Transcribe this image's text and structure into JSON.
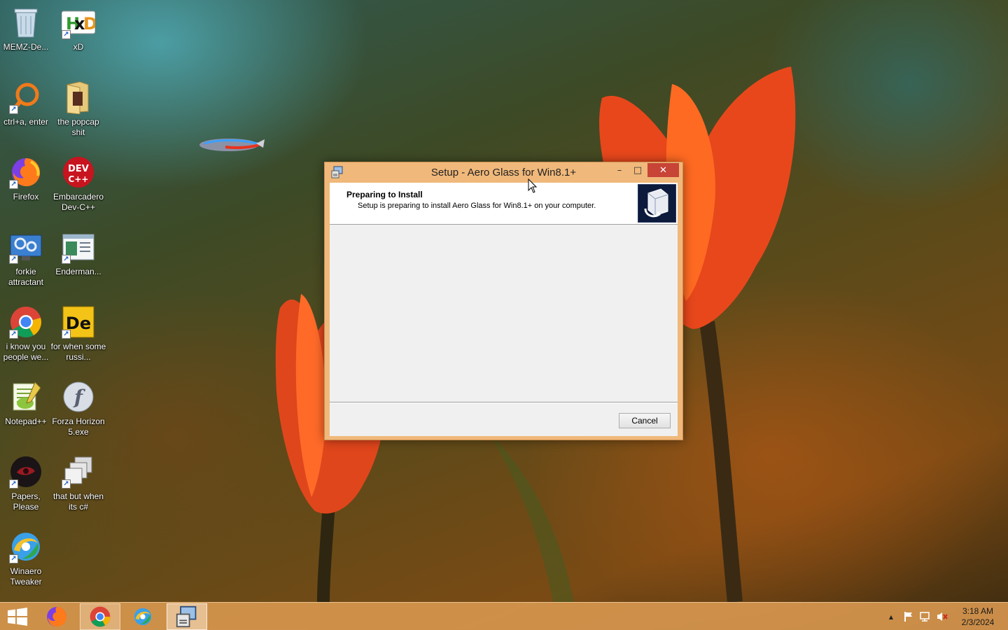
{
  "desktop": {
    "icons": [
      {
        "label": "MEMZ-De...",
        "icon": "recycle-bin-icon"
      },
      {
        "label": "xD",
        "icon": "hxd-icon"
      },
      {
        "label": "ctrl+a, enter",
        "icon": "magnifier-icon"
      },
      {
        "label": "the popcap shit",
        "icon": "folder-icon"
      },
      {
        "label": "Firefox",
        "icon": "firefox-icon"
      },
      {
        "label": "Embarcadero Dev-C++",
        "icon": "devcpp-icon",
        "badge": "DEV C++"
      },
      {
        "label": "forkie attractant",
        "icon": "settings-monitor-icon"
      },
      {
        "label": "Enderman...",
        "icon": "window-app-icon"
      },
      {
        "label": "i know you people we...",
        "icon": "chrome-icon"
      },
      {
        "label": "for when some russi...",
        "icon": "de-icon",
        "badge": "De"
      },
      {
        "label": "Notepad++",
        "icon": "notepad-plus-plus-icon"
      },
      {
        "label": "Forza Horizon 5.exe",
        "icon": "flash-icon"
      },
      {
        "label": "Papers, Please",
        "icon": "papers-please-icon"
      },
      {
        "label": "that but when its c#",
        "icon": "stacked-windows-icon"
      },
      {
        "label": "Winaero Tweaker",
        "icon": "winaero-icon"
      }
    ]
  },
  "window": {
    "title": "Setup - Aero Glass for Win8.1+",
    "heading": "Preparing to Install",
    "subheading": "Setup is preparing to install Aero Glass for Win8.1+ on your computer.",
    "cancel_label": "Cancel",
    "minimize_glyph": "–",
    "maximize_glyph": "□",
    "close_glyph": "✕"
  },
  "taskbar": {
    "items": [
      {
        "name": "start",
        "icon": "windows-start-icon"
      },
      {
        "name": "firefox",
        "icon": "firefox-icon"
      },
      {
        "name": "chrome",
        "icon": "chrome-icon"
      },
      {
        "name": "winaero",
        "icon": "winaero-icon"
      },
      {
        "name": "setup",
        "icon": "setup-icon"
      }
    ],
    "tray": {
      "show_hidden_glyph": "▲",
      "icons": [
        "flag-icon",
        "network-icon",
        "volume-muted-icon"
      ]
    },
    "clock": {
      "time": "3:18 AM",
      "date": "2/3/2024"
    }
  },
  "colors": {
    "window_frame": "#f0b87a",
    "close_button": "#c74437",
    "taskbar": "#d6964e"
  }
}
